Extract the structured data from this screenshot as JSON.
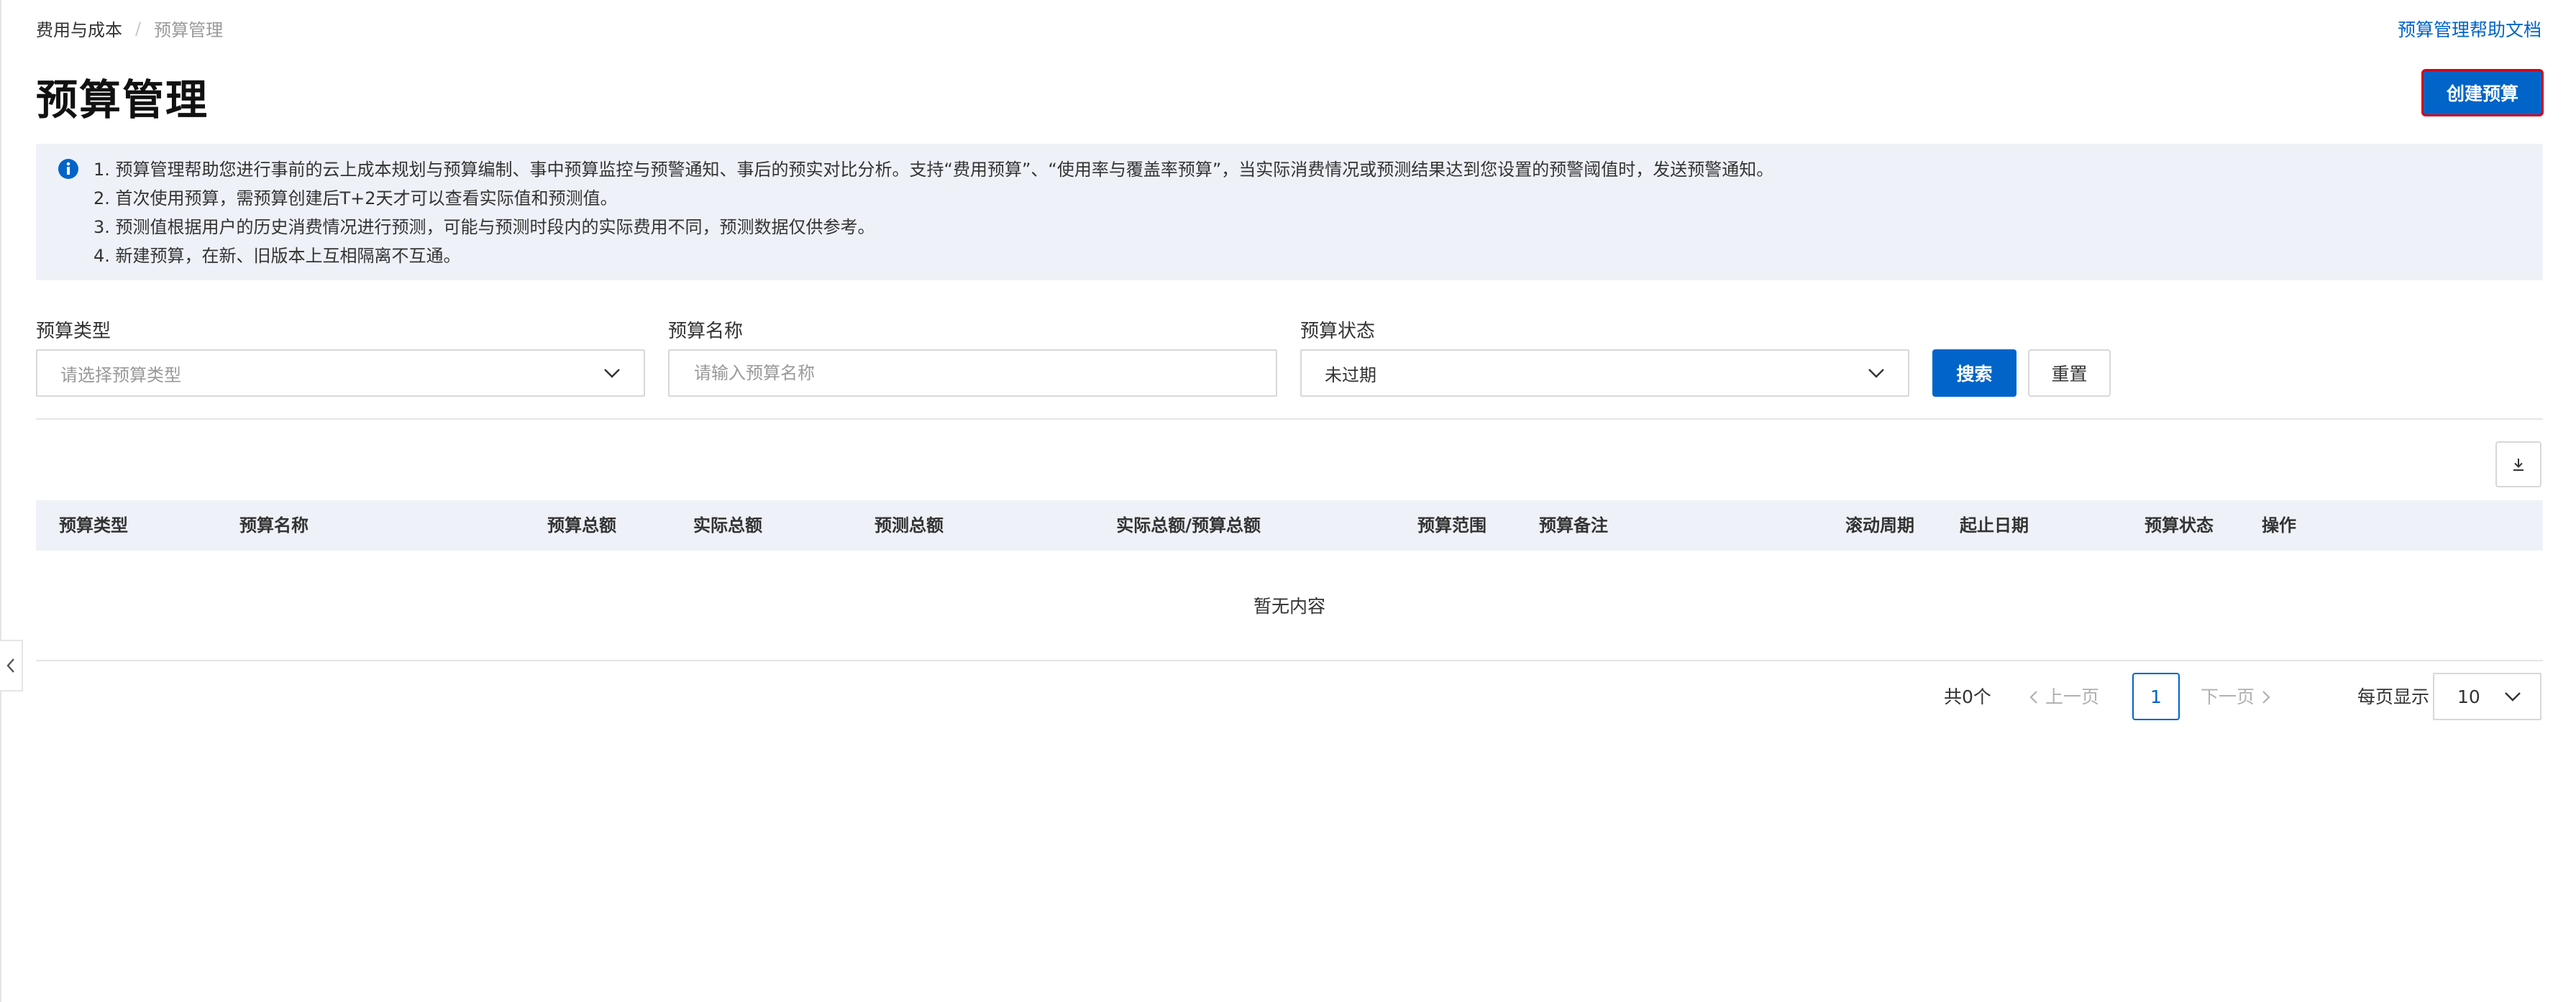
{
  "breadcrumb": {
    "parent": "费用与成本",
    "separator": "/",
    "current": "预算管理"
  },
  "header": {
    "help_link": "预算管理帮助文档",
    "title": "预算管理",
    "create_button": "创建预算"
  },
  "notice": {
    "icon": "info-icon",
    "lines": [
      "1. 预算管理帮助您进行事前的云上成本规划与预算编制、事中预算监控与预警通知、事后的预实对比分析。支持“费用预算”、“使用率与覆盖率预算”，当实际消费情况或预测结果达到您设置的预警阈值时，发送预警通知。",
      "2. 首次使用预算，需预算创建后T+2天才可以查看实际值和预测值。",
      "3. 预测值根据用户的历史消费情况进行预测，可能与预测时段内的实际费用不同，预测数据仅供参考。",
      "4. 新建预算，在新、旧版本上互相隔离不互通。"
    ]
  },
  "filters": {
    "type_label": "预算类型",
    "type_placeholder": "请选择预算类型",
    "name_label": "预算名称",
    "name_placeholder": "请输入预算名称",
    "status_label": "预算状态",
    "status_value": "未过期",
    "search_button": "搜索",
    "reset_button": "重置"
  },
  "table": {
    "columns": [
      "预算类型",
      "预算名称",
      "预算总额",
      "实际总额",
      "预测总额",
      "实际总额/预算总额",
      "预算范围",
      "预算备注",
      "滚动周期",
      "起止日期",
      "预算状态",
      "操作"
    ],
    "empty_text": "暂无内容"
  },
  "pagination": {
    "total": "共0个",
    "prev": "上一页",
    "current_page": "1",
    "next": "下一页",
    "per_page_label": "每页显示",
    "per_page_value": "10"
  },
  "colors": {
    "accent": "#0064c8",
    "notice_bg": "#eef2f8",
    "highlight_border": "#d0021b"
  }
}
